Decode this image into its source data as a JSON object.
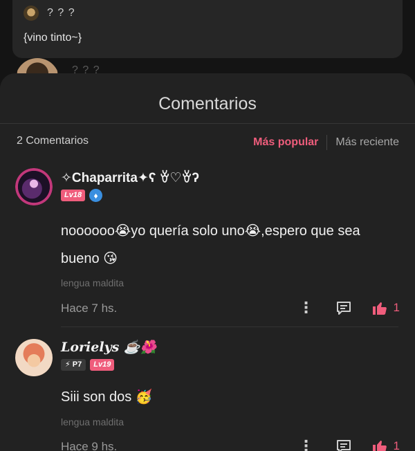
{
  "background_chat": {
    "top_user": "? ? ?",
    "top_message": "{vino tinto~}",
    "second_user": "? ? ?"
  },
  "sheet": {
    "title": "Comentarios",
    "count_label": "2 Comentarios",
    "sort_popular": "Más popular",
    "sort_recent": "Más reciente"
  },
  "comments": [
    {
      "username": "✧Chaparrita✦ʕ ꈊ♡ꈊʔ",
      "level": "Lv18",
      "badge_icon": "ethereum-icon",
      "body_line1": "noooooo😭yo quería solo uno😭,espero que sea",
      "body_line2": "bueno 😘",
      "signature": "lengua maldita",
      "time": "Hace 7 hs.",
      "likes": "1"
    },
    {
      "username": "Lorielys ☕🌺",
      "points_badge": "⚡ P7",
      "level": "Lv19",
      "body_line1": "Siii son dos 🥳",
      "signature": "lengua maldita",
      "time": "Hace 9 hs.",
      "likes": "1"
    }
  ],
  "colors": {
    "accent": "#ef5d7c",
    "sheet_bg": "#222222",
    "page_bg": "#141414"
  }
}
